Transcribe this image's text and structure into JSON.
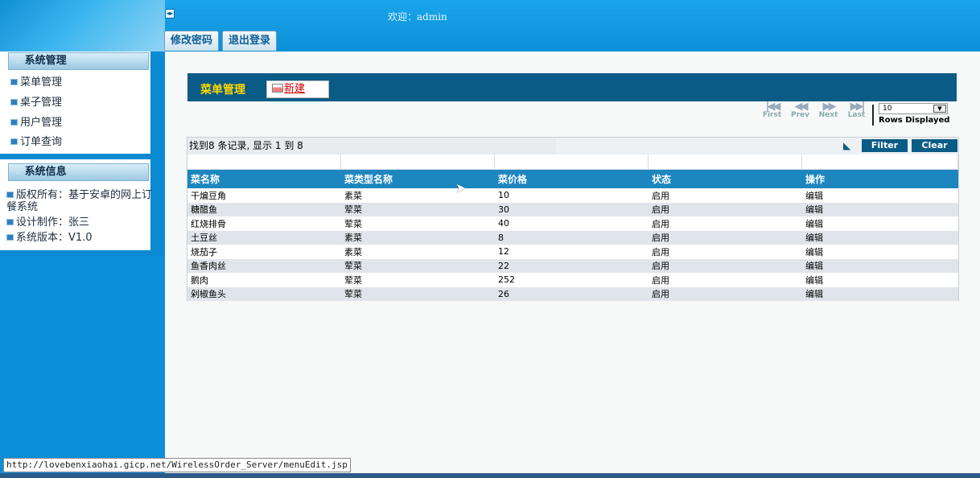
{
  "header": {
    "welcome": "欢迎：admin",
    "tabs": [
      "修改密码",
      "退出登录"
    ]
  },
  "sidebar": {
    "system_mgmt": {
      "title": "系统管理",
      "items": [
        "菜单管理",
        "桌子管理",
        "用户管理",
        "订单查询"
      ]
    },
    "system_info": {
      "title": "系统信息",
      "items": [
        "版权所有：基于安卓的网上订餐系统",
        "设计制作：张三",
        "系统版本：V1.0"
      ]
    }
  },
  "main": {
    "title": "菜单管理",
    "new_label": "新建",
    "pager": {
      "first": "First",
      "prev": "Prev",
      "next": "Next",
      "last": "Last",
      "rows_value": "10",
      "rows_label": "Rows Displayed"
    },
    "found_text": "找到8 条记录, 显示 1 到 8",
    "filter_label": "Filter",
    "clear_label": "Clear",
    "columns": [
      "菜名称",
      "菜类型名称",
      "菜价格",
      "状态",
      "操作"
    ],
    "rows": [
      [
        "干煸豆角",
        "素菜",
        "10",
        "启用",
        "编辑"
      ],
      [
        "糖醋鱼",
        "荤菜",
        "30",
        "启用",
        "编辑"
      ],
      [
        "红烧排骨",
        "荤菜",
        "40",
        "启用",
        "编辑"
      ],
      [
        "土豆丝",
        "素菜",
        "8",
        "启用",
        "编辑"
      ],
      [
        "烧茄子",
        "素菜",
        "12",
        "启用",
        "编辑"
      ],
      [
        "鱼香肉丝",
        "荤菜",
        "22",
        "启用",
        "编辑"
      ],
      [
        "鹅肉",
        "荤菜",
        "252",
        "启用",
        "编辑"
      ],
      [
        "剁椒鱼头",
        "荤菜",
        "26",
        "启用",
        "编辑"
      ]
    ]
  },
  "status_bar": {
    "url": "http://lovebenxiaohai.gicp.net/WirelessOrder_Server/menuEdit.jsp"
  }
}
